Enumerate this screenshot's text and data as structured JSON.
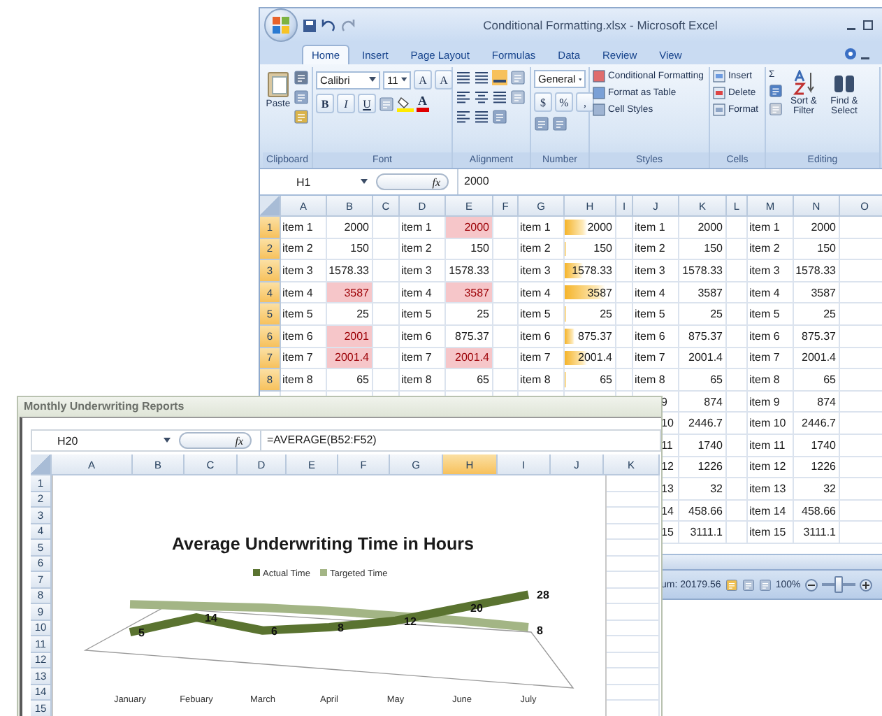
{
  "excel_window": {
    "title": "Conditional Formatting.xlsx - Microsoft Excel",
    "tabs": [
      {
        "label": "Home",
        "selected": true
      },
      {
        "label": "Insert",
        "selected": false
      },
      {
        "label": "Page Layout",
        "selected": false
      },
      {
        "label": "Formulas",
        "selected": false
      },
      {
        "label": "Data",
        "selected": false
      },
      {
        "label": "Review",
        "selected": false
      },
      {
        "label": "View",
        "selected": false
      }
    ],
    "clipboard": {
      "label": "Clipboard",
      "paste": "Paste"
    },
    "font": {
      "label": "Font",
      "name": "Calibri",
      "size": "11",
      "grow": "A",
      "shrink": "A",
      "bold": "B",
      "italic": "I",
      "underline": "U",
      "font_color_button": "A"
    },
    "alignment": {
      "label": "Alignment"
    },
    "number": {
      "label": "Number",
      "format": "General",
      "currency": "$",
      "percent": "%",
      "comma": ","
    },
    "styles": {
      "label": "Styles",
      "items": [
        "Conditional Formatting",
        "Format as Table",
        "Cell Styles"
      ]
    },
    "cells": {
      "label": "Cells",
      "items": [
        "Insert",
        "Delete",
        "Format"
      ]
    },
    "editing": {
      "label": "Editing",
      "sum": "Σ",
      "sort": "Sort & Filter",
      "find": "Find & Select"
    },
    "formula_bar": {
      "name_box": "H1",
      "fx": "fx",
      "formula": "2000"
    },
    "columns": [
      "A",
      "B",
      "C",
      "D",
      "E",
      "F",
      "G",
      "H",
      "I",
      "J",
      "K",
      "L",
      "M",
      "N",
      "O"
    ],
    "rows": [
      {
        "header": "1",
        "selected": true,
        "cells": [
          {
            "kind": "text",
            "text": "item 1"
          },
          {
            "kind": "number",
            "text": "2000",
            "highlighted": false
          },
          "",
          {
            "kind": "text",
            "text": "item 1"
          },
          {
            "kind": "number",
            "text": "2000",
            "highlighted": true
          },
          "",
          {
            "kind": "text",
            "text": "item 1"
          },
          {
            "kind": "bar",
            "text": "2000",
            "level": 0.45
          },
          "",
          {
            "kind": "text",
            "text": "item 1"
          },
          {
            "kind": "number",
            "text": "2000",
            "highlighted": false
          },
          "",
          {
            "kind": "text",
            "text": "item 1"
          },
          {
            "kind": "number",
            "text": "2000",
            "highlighted": false
          },
          ""
        ]
      },
      {
        "header": "2",
        "selected": true,
        "cells": [
          {
            "kind": "text",
            "text": "item 2"
          },
          {
            "kind": "number",
            "text": "150",
            "highlighted": false
          },
          "",
          {
            "kind": "text",
            "text": "item 2"
          },
          {
            "kind": "number",
            "text": "150",
            "highlighted": false
          },
          "",
          {
            "kind": "text",
            "text": "item 2"
          },
          {
            "kind": "bar",
            "text": "150",
            "level": 0.04
          },
          "",
          {
            "kind": "text",
            "text": "item 2"
          },
          {
            "kind": "number",
            "text": "150",
            "highlighted": false
          },
          "",
          {
            "kind": "text",
            "text": "item 2"
          },
          {
            "kind": "number",
            "text": "150",
            "highlighted": false
          },
          ""
        ]
      },
      {
        "header": "3",
        "selected": true,
        "cells": [
          {
            "kind": "text",
            "text": "item 3"
          },
          {
            "kind": "number",
            "text": "1578.33",
            "highlighted": false
          },
          "",
          {
            "kind": "text",
            "text": "item 3"
          },
          {
            "kind": "number",
            "text": "1578.33",
            "highlighted": false
          },
          "",
          {
            "kind": "text",
            "text": "item 3"
          },
          {
            "kind": "bar",
            "text": "1578.33",
            "level": 0.36
          },
          "",
          {
            "kind": "text",
            "text": "item 3"
          },
          {
            "kind": "number",
            "text": "1578.33",
            "highlighted": false
          },
          "",
          {
            "kind": "text",
            "text": "item 3"
          },
          {
            "kind": "number",
            "text": "1578.33",
            "highlighted": false
          },
          ""
        ]
      },
      {
        "header": "4",
        "selected": true,
        "cells": [
          {
            "kind": "text",
            "text": "item 4"
          },
          {
            "kind": "number",
            "text": "3587",
            "highlighted": true
          },
          "",
          {
            "kind": "text",
            "text": "item 4"
          },
          {
            "kind": "number",
            "text": "3587",
            "highlighted": true
          },
          "",
          {
            "kind": "text",
            "text": "item 4"
          },
          {
            "kind": "bar",
            "text": "3587",
            "level": 0.81
          },
          "",
          {
            "kind": "text",
            "text": "item 4"
          },
          {
            "kind": "number",
            "text": "3587",
            "highlighted": false
          },
          "",
          {
            "kind": "text",
            "text": "item 4"
          },
          {
            "kind": "number",
            "text": "3587",
            "highlighted": false
          },
          ""
        ]
      },
      {
        "header": "5",
        "selected": true,
        "cells": [
          {
            "kind": "text",
            "text": "item 5"
          },
          {
            "kind": "number",
            "text": "25",
            "highlighted": false
          },
          "",
          {
            "kind": "text",
            "text": "item 5"
          },
          {
            "kind": "number",
            "text": "25",
            "highlighted": false
          },
          "",
          {
            "kind": "text",
            "text": "item 5"
          },
          {
            "kind": "bar",
            "text": "25",
            "level": 0.02
          },
          "",
          {
            "kind": "text",
            "text": "item 5"
          },
          {
            "kind": "number",
            "text": "25",
            "highlighted": false
          },
          "",
          {
            "kind": "text",
            "text": "item 5"
          },
          {
            "kind": "number",
            "text": "25",
            "highlighted": false
          },
          ""
        ]
      },
      {
        "header": "6",
        "selected": true,
        "cells": [
          {
            "kind": "text",
            "text": "item 6"
          },
          {
            "kind": "number",
            "text": "2001",
            "highlighted": true
          },
          "",
          {
            "kind": "text",
            "text": "item 6"
          },
          {
            "kind": "number",
            "text": "875.37",
            "highlighted": false
          },
          "",
          {
            "kind": "text",
            "text": "item 6"
          },
          {
            "kind": "bar",
            "text": "875.37",
            "level": 0.2
          },
          "",
          {
            "kind": "text",
            "text": "item 6"
          },
          {
            "kind": "number",
            "text": "875.37",
            "highlighted": false
          },
          "",
          {
            "kind": "text",
            "text": "item 6"
          },
          {
            "kind": "number",
            "text": "875.37",
            "highlighted": false
          },
          ""
        ]
      },
      {
        "header": "7",
        "selected": true,
        "cells": [
          {
            "kind": "text",
            "text": "item 7"
          },
          {
            "kind": "number",
            "text": "2001.4",
            "highlighted": true
          },
          "",
          {
            "kind": "text",
            "text": "item 7"
          },
          {
            "kind": "number",
            "text": "2001.4",
            "highlighted": true
          },
          "",
          {
            "kind": "text",
            "text": "item 7"
          },
          {
            "kind": "bar",
            "text": "2001.4",
            "level": 0.45
          },
          "",
          {
            "kind": "text",
            "text": "item 7"
          },
          {
            "kind": "number",
            "text": "2001.4",
            "highlighted": false
          },
          "",
          {
            "kind": "text",
            "text": "item 7"
          },
          {
            "kind": "number",
            "text": "2001.4",
            "highlighted": false
          },
          ""
        ]
      },
      {
        "header": "8",
        "selected": true,
        "cells": [
          {
            "kind": "text",
            "text": "item 8"
          },
          {
            "kind": "number",
            "text": "65",
            "highlighted": false
          },
          "",
          {
            "kind": "text",
            "text": "item 8"
          },
          {
            "kind": "number",
            "text": "65",
            "highlighted": false
          },
          "",
          {
            "kind": "text",
            "text": "item 8"
          },
          {
            "kind": "bar",
            "text": "65",
            "level": 0.02
          },
          "",
          {
            "kind": "text",
            "text": "item 8"
          },
          {
            "kind": "number",
            "text": "65",
            "highlighted": false
          },
          "",
          {
            "kind": "text",
            "text": "item 8"
          },
          {
            "kind": "number",
            "text": "65",
            "highlighted": false
          },
          ""
        ]
      }
    ],
    "rows_partly_hidden": [
      {
        "cells": [
          "",
          "",
          "",
          "",
          "",
          "",
          "",
          "",
          "",
          {
            "kind": "cut_text",
            "text": "9"
          },
          {
            "kind": "number",
            "text": "874",
            "highlighted": false
          },
          "",
          {
            "kind": "text",
            "text": "item 9"
          },
          {
            "kind": "number",
            "text": "874",
            "highlighted": false
          },
          ""
        ]
      },
      {
        "cells": [
          "",
          "",
          "",
          "",
          "",
          "",
          "",
          "",
          "",
          {
            "kind": "cut_text",
            "text": "10"
          },
          {
            "kind": "number",
            "text": "2446.7",
            "highlighted": false
          },
          "",
          {
            "kind": "text",
            "text": "item 10"
          },
          {
            "kind": "number",
            "text": "2446.7",
            "highlighted": false
          },
          ""
        ]
      },
      {
        "cells": [
          "",
          "",
          "",
          "",
          "",
          "",
          "",
          "",
          "",
          {
            "kind": "cut_text",
            "text": "11"
          },
          {
            "kind": "number",
            "text": "1740",
            "highlighted": false
          },
          "",
          {
            "kind": "text",
            "text": "item 11"
          },
          {
            "kind": "number",
            "text": "1740",
            "highlighted": false
          },
          ""
        ]
      },
      {
        "cells": [
          "",
          "",
          "",
          "",
          "",
          "",
          "",
          "",
          "",
          {
            "kind": "cut_text",
            "text": "12"
          },
          {
            "kind": "number",
            "text": "1226",
            "highlighted": false
          },
          "",
          {
            "kind": "text",
            "text": "item 12"
          },
          {
            "kind": "number",
            "text": "1226",
            "highlighted": false
          },
          ""
        ]
      },
      {
        "cells": [
          "",
          "",
          "",
          "",
          "",
          "",
          "",
          "",
          "",
          {
            "kind": "cut_text",
            "text": "13"
          },
          {
            "kind": "number",
            "text": "32",
            "highlighted": false
          },
          "",
          {
            "kind": "text",
            "text": "item 13"
          },
          {
            "kind": "number",
            "text": "32",
            "highlighted": false
          },
          ""
        ]
      },
      {
        "cells": [
          "",
          "",
          "",
          "",
          "",
          "",
          "",
          "",
          "",
          {
            "kind": "cut_text",
            "text": "14"
          },
          {
            "kind": "number",
            "text": "458.66",
            "highlighted": false
          },
          "",
          {
            "kind": "text",
            "text": "item 14"
          },
          {
            "kind": "number",
            "text": "458.66",
            "highlighted": false
          },
          ""
        ]
      },
      {
        "cells": [
          "",
          "",
          "",
          "",
          "",
          "",
          "",
          "",
          "",
          {
            "kind": "cut_text",
            "text": "15"
          },
          {
            "kind": "number",
            "text": "3111.1",
            "highlighted": false
          },
          "",
          {
            "kind": "text",
            "text": "item 15"
          },
          {
            "kind": "number",
            "text": "3111.1",
            "highlighted": false
          },
          ""
        ]
      }
    ],
    "status_bar": {
      "text": "um: 20179.56",
      "zoom": "100%",
      "zoom_slider": {
        "level": 0.5
      }
    }
  },
  "report_window": {
    "title": "Monthly Underwriting Reports",
    "formula_bar": {
      "name_box": "H20",
      "fx": "fx",
      "formula": "=AVERAGE(B52:F52)"
    },
    "columns": [
      {
        "label": "A",
        "selected": false
      },
      {
        "label": "B",
        "selected": false
      },
      {
        "label": "C",
        "selected": false
      },
      {
        "label": "D",
        "selected": false
      },
      {
        "label": "E",
        "selected": false
      },
      {
        "label": "F",
        "selected": false
      },
      {
        "label": "G",
        "selected": false
      },
      {
        "label": "H",
        "selected": true
      },
      {
        "label": "I",
        "selected": false
      },
      {
        "label": "J",
        "selected": false
      },
      {
        "label": "K",
        "selected": false
      }
    ],
    "rows": [
      "1",
      "2",
      "3",
      "4",
      "5",
      "6",
      "7",
      "8",
      "9",
      "10",
      "11",
      "12",
      "13",
      "14",
      "15"
    ],
    "chart_data": {
      "type": "line",
      "title": "Average Underwriting Time in Hours",
      "legend": "top",
      "categories": [
        "January",
        "Febuary",
        "March",
        "April",
        "May",
        "June",
        "July"
      ],
      "series": [
        {
          "name": "Actual Time",
          "color": "#5a7330",
          "values": [
            5,
            14,
            6,
            8,
            12,
            20,
            28
          ],
          "value_labels": [
            "5",
            "14",
            "6",
            "8",
            "12",
            "20",
            "28"
          ]
        },
        {
          "name": "Targeted Time",
          "color": "#a3b585",
          "values": [
            22,
            21,
            20,
            18,
            15,
            12,
            8
          ],
          "value_labels": [
            null,
            null,
            null,
            null,
            null,
            null,
            "8"
          ]
        }
      ]
    }
  }
}
